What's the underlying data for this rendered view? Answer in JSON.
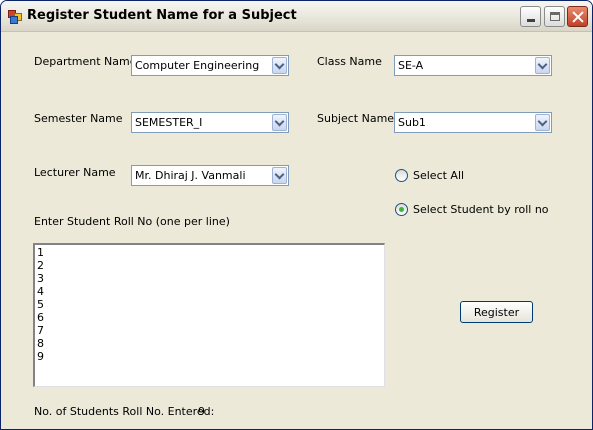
{
  "window": {
    "title": "Register Student Name for a Subject"
  },
  "form": {
    "department": {
      "label": "Department Name",
      "value": "Computer Engineering"
    },
    "class_name": {
      "label": "Class Name",
      "value": "SE-A"
    },
    "semester": {
      "label": "Semester Name",
      "value": "SEMESTER_I"
    },
    "subject": {
      "label": "Subject Name",
      "value": "Sub1"
    },
    "lecturer": {
      "label": "Lecturer Name",
      "value": "Mr. Dhiraj J. Vanmali"
    },
    "select_all": {
      "label": "Select All",
      "selected": false
    },
    "select_by_roll": {
      "label": "Select Student by roll no",
      "selected": true
    },
    "roll_entry_label": "Enter Student Roll No (one per line)",
    "roll_numbers": [
      "1",
      "2",
      "3",
      "4",
      "5",
      "6",
      "7",
      "8",
      "9"
    ],
    "register_button": "Register",
    "count_label": "No. of Students Roll No. Entered:",
    "count_value": "9"
  },
  "colors": {
    "window_bg": "#ece9d8",
    "radio_dot": "#3cb43c",
    "close_button": "#c1402a",
    "border_blue": "#7f9db9"
  }
}
